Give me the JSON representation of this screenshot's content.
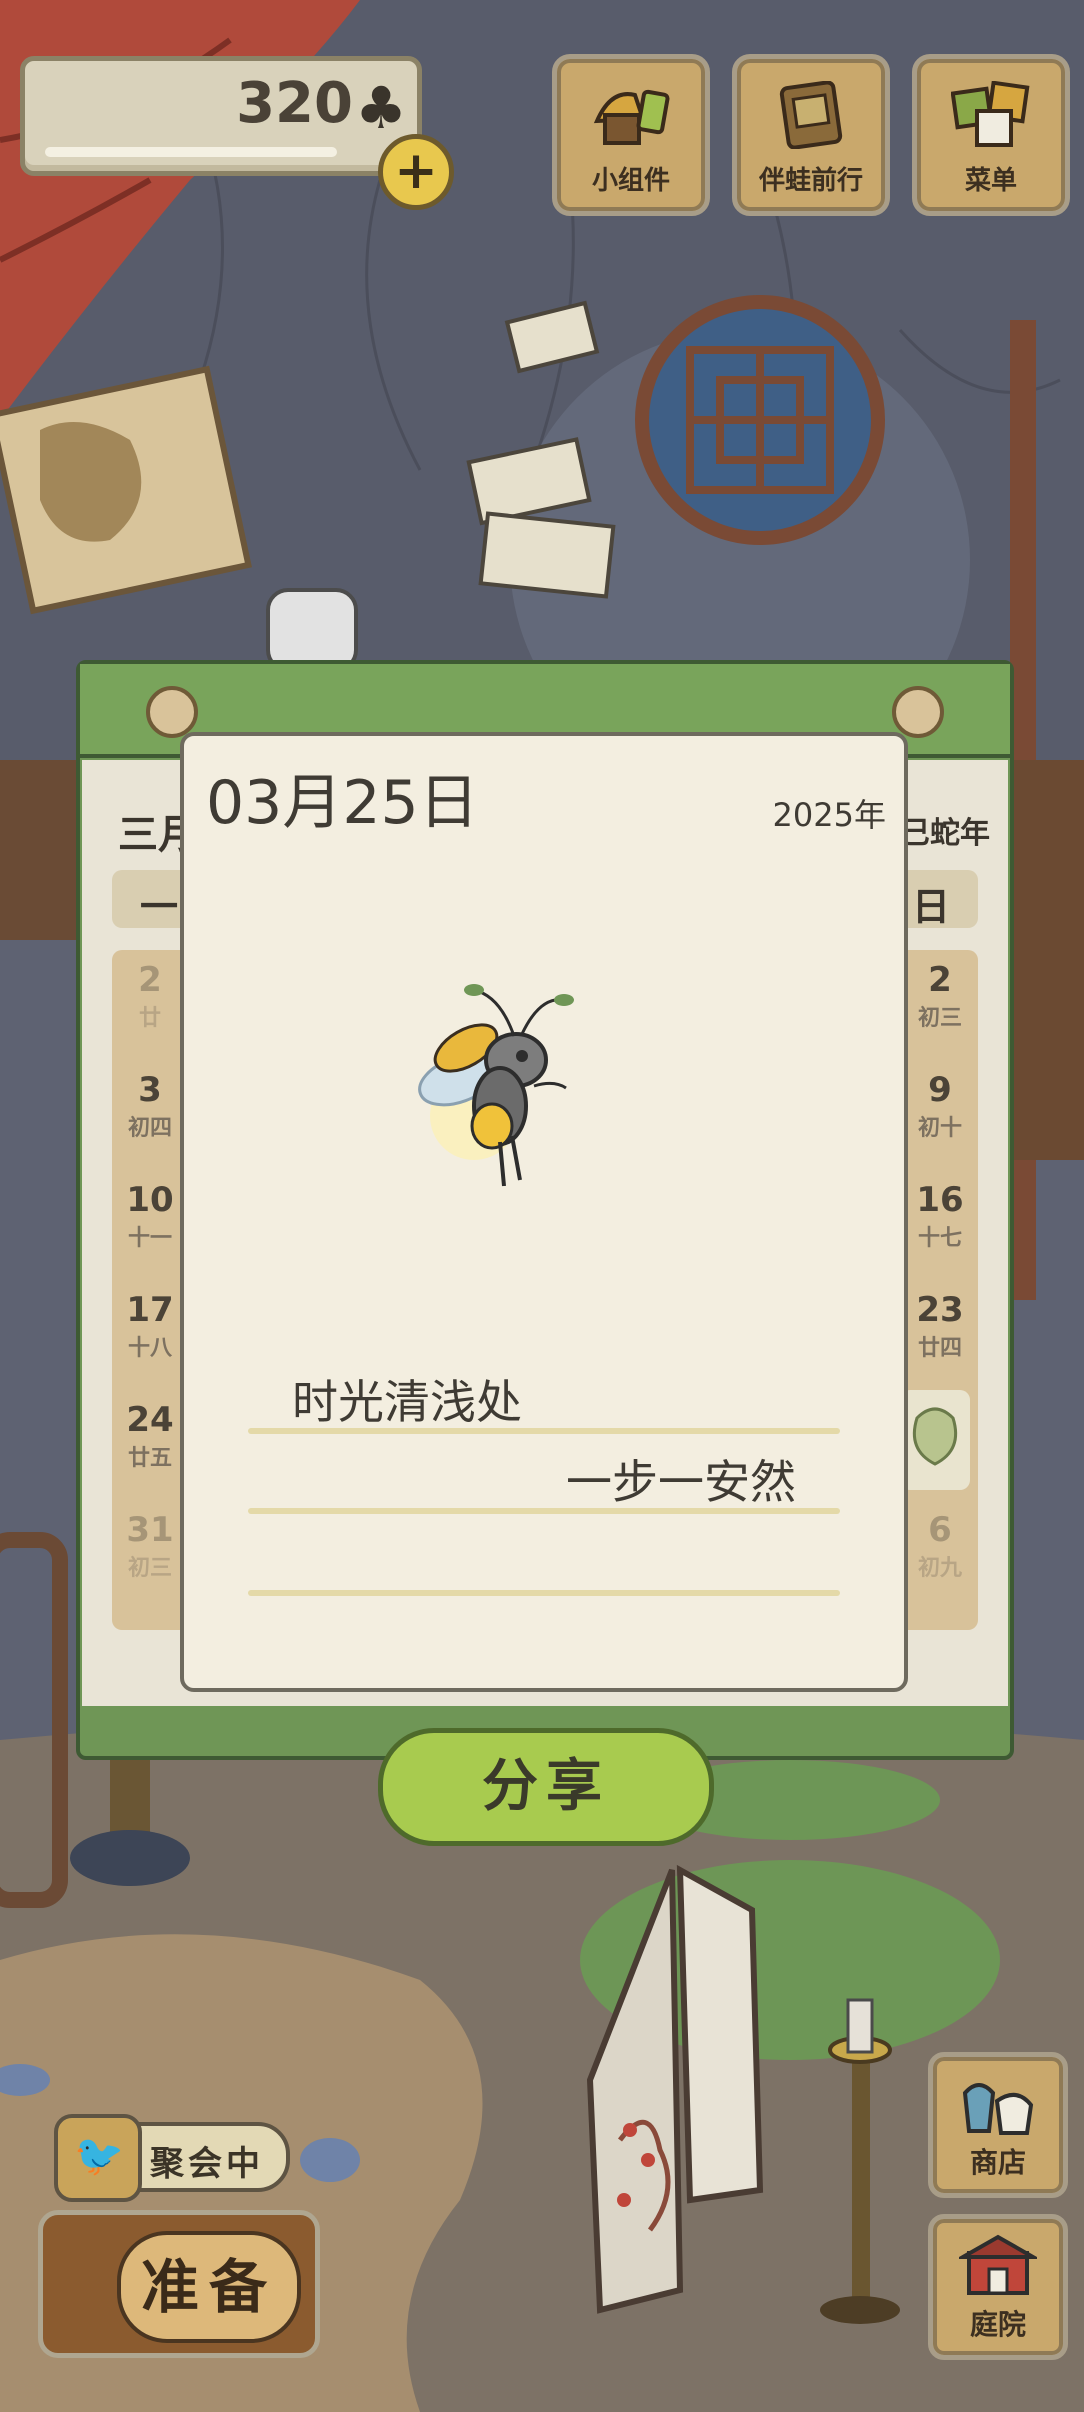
{
  "hud": {
    "clover_count": "320",
    "clover_icon": "♣",
    "plus_icon": "+",
    "buttons": [
      {
        "label": "小组件",
        "icon": "widget-icon"
      },
      {
        "label": "伴蛙前行",
        "icon": "journal-icon"
      },
      {
        "label": "菜单",
        "icon": "menu-icon"
      }
    ]
  },
  "calendar_back": {
    "month": "三月",
    "year": "乙巳蛇年",
    "weekday_left": "一",
    "weekday_right": "日",
    "cells_left": [
      {
        "num": "2",
        "lunar": "廿"
      },
      {
        "num": "3",
        "lunar": "初四"
      },
      {
        "num": "10",
        "lunar": "十一"
      },
      {
        "num": "17",
        "lunar": "十八"
      },
      {
        "num": "24",
        "lunar": "廿五"
      },
      {
        "num": "31",
        "lunar": "初三"
      }
    ],
    "cells_right": [
      {
        "num": "2",
        "lunar": "初三"
      },
      {
        "num": "9",
        "lunar": "初十"
      },
      {
        "num": "16",
        "lunar": "十七"
      },
      {
        "num": "23",
        "lunar": "廿四"
      },
      {
        "num": "",
        "lunar": ""
      },
      {
        "num": "6",
        "lunar": "初九"
      }
    ]
  },
  "calendar_page": {
    "date": "03月25日",
    "year": "2025年",
    "line1": "时光清浅处",
    "line2": "一步一安然",
    "illustration": "firefly-character"
  },
  "share_label": "分享",
  "party_label": "聚会中",
  "ready_label": "准备",
  "side_buttons": [
    {
      "label": "商店",
      "icon": "shop-icon"
    },
    {
      "label": "庭院",
      "icon": "yard-icon"
    }
  ]
}
